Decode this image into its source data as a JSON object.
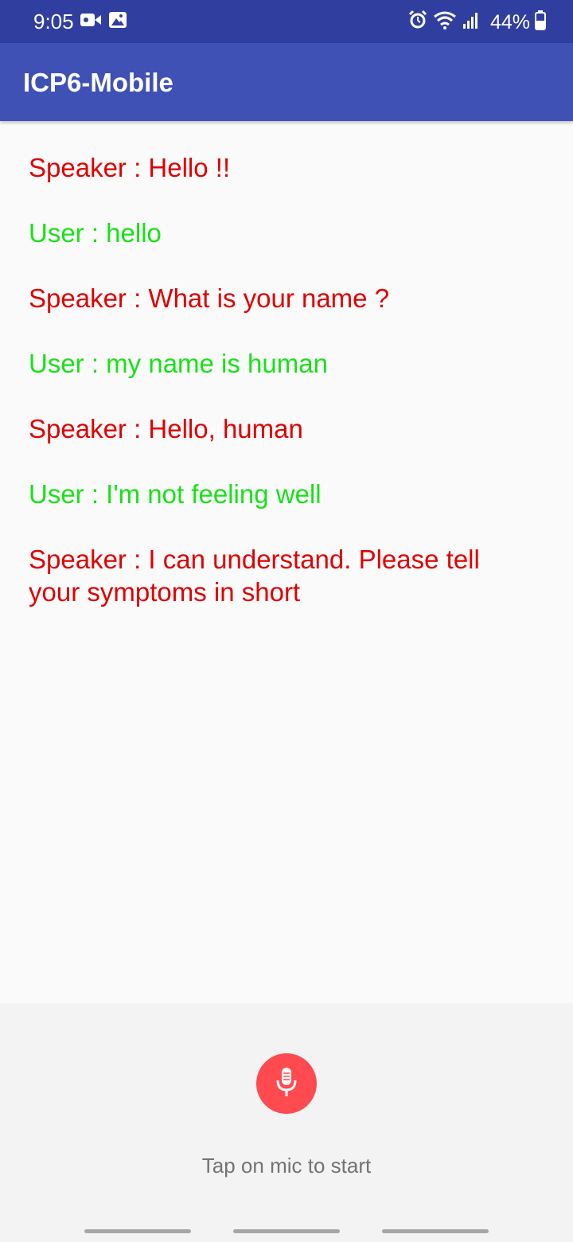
{
  "status_bar": {
    "time": "9:05",
    "battery": "44%",
    "background_color": "#303f9f"
  },
  "app_bar": {
    "title": "ICP6-Mobile",
    "background_color": "#3f51b5"
  },
  "conversation": {
    "speaker_color": "#e00000",
    "user_color": "#17e217",
    "messages": [
      {
        "role": "speaker",
        "text": "Speaker : Hello !!"
      },
      {
        "role": "user",
        "text": "User : hello"
      },
      {
        "role": "speaker",
        "text": "Speaker : What is your name ?"
      },
      {
        "role": "user",
        "text": "User : my name is human"
      },
      {
        "role": "speaker",
        "text": "Speaker : Hello, human"
      },
      {
        "role": "user",
        "text": "User : I'm not feeling well"
      },
      {
        "role": "speaker",
        "text": "Speaker : I can understand. Please tell your symptoms in short"
      }
    ]
  },
  "mic": {
    "icon": "microphone-icon",
    "hint": "Tap on mic to start",
    "button_color": "#ff4a4f"
  }
}
